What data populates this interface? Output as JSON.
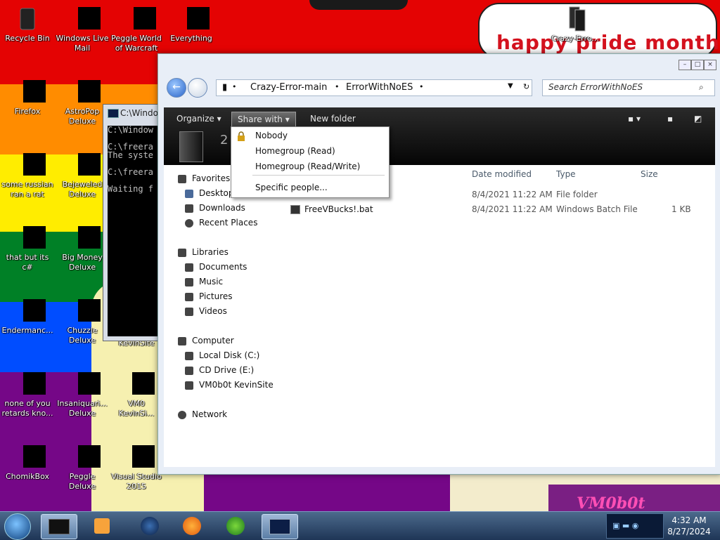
{
  "desktop": {
    "stripe_colors": [
      "#e40303",
      "#ff8c00",
      "#ffed00",
      "#008026",
      "#004dff",
      "#750787"
    ],
    "icons": [
      {
        "label": "Recycle Bin",
        "icon": "recycle-bin-icon"
      },
      {
        "label": "Windows Live Mail",
        "icon": "mail-icon"
      },
      {
        "label": "Peggle World of Warcraft",
        "icon": "game-icon"
      },
      {
        "label": "Everything",
        "icon": "search-app-icon"
      },
      {
        "label": "Firefox",
        "icon": "firefox-icon"
      },
      {
        "label": "AstroPop Deluxe",
        "icon": "game-icon"
      },
      {
        "label": "some russian ran a rat",
        "icon": "app-icon"
      },
      {
        "label": "Bejeweled Deluxe",
        "icon": "game-icon"
      },
      {
        "label": "that but its c#",
        "icon": "app-icon"
      },
      {
        "label": "Big Money Deluxe",
        "icon": "game-icon"
      },
      {
        "label": "Endermanc...",
        "icon": "app-icon"
      },
      {
        "label": "Chuzzle Deluxe",
        "icon": "game-icon"
      },
      {
        "label": "KevinSite",
        "icon": "app-icon"
      },
      {
        "label": "none of you retards kno...",
        "icon": "app-icon"
      },
      {
        "label": "Insaniquari... Deluxe",
        "icon": "game-icon"
      },
      {
        "label": "VM0 KevinSi...",
        "icon": "app-icon"
      },
      {
        "label": "ChomikBox",
        "icon": "app-icon"
      },
      {
        "label": "Peggle Deluxe",
        "icon": "game-icon"
      },
      {
        "label": "Visual Studio 2015",
        "icon": "visual-studio-icon"
      },
      {
        "label": "Crazy-Erro...",
        "icon": "folder-icon"
      }
    ],
    "banner_text": "happy pride month",
    "corner_text": "VM0b0t"
  },
  "cmd": {
    "title": "C:\\Windo",
    "lines": "C:\\Window\n\nC:\\freera\nThe syste\n\nC:\\freera\n\nWaiting f"
  },
  "explorer": {
    "address": {
      "seg1": "Crazy-Error-main",
      "seg2": "ErrorWithNoES"
    },
    "search_placeholder": "Search ErrorWithNoES",
    "toolbar": {
      "organize": "Organize",
      "share_with": "Share with",
      "new_folder": "New folder"
    },
    "preview_count": "2",
    "nav": {
      "favorites": "Favorites",
      "desktop": "Desktop",
      "downloads": "Downloads",
      "recent": "Recent Places",
      "libraries": "Libraries",
      "documents": "Documents",
      "music": "Music",
      "pictures": "Pictures",
      "videos": "Videos",
      "computer": "Computer",
      "local_disk": "Local Disk (C:)",
      "cd_drive": "CD Drive (E:)",
      "vm": "VM0b0t KevinSite",
      "network": "Network"
    },
    "columns": {
      "date": "Date modified",
      "type": "Type",
      "size": "Size"
    },
    "rows": [
      {
        "name": "",
        "date": "8/4/2021 11:22 AM",
        "type": "File folder",
        "size": ""
      },
      {
        "name": "FreeVBucks!.bat",
        "date": "8/4/2021 11:22 AM",
        "type": "Windows Batch File",
        "size": "1 KB"
      }
    ]
  },
  "share_menu": {
    "nobody": "Nobody",
    "homegroup_read": "Homegroup (Read)",
    "homegroup_rw": "Homegroup (Read/Write)",
    "specific": "Specific people..."
  },
  "taskbar": {
    "time": "4:32 AM",
    "date": "8/27/2024"
  }
}
